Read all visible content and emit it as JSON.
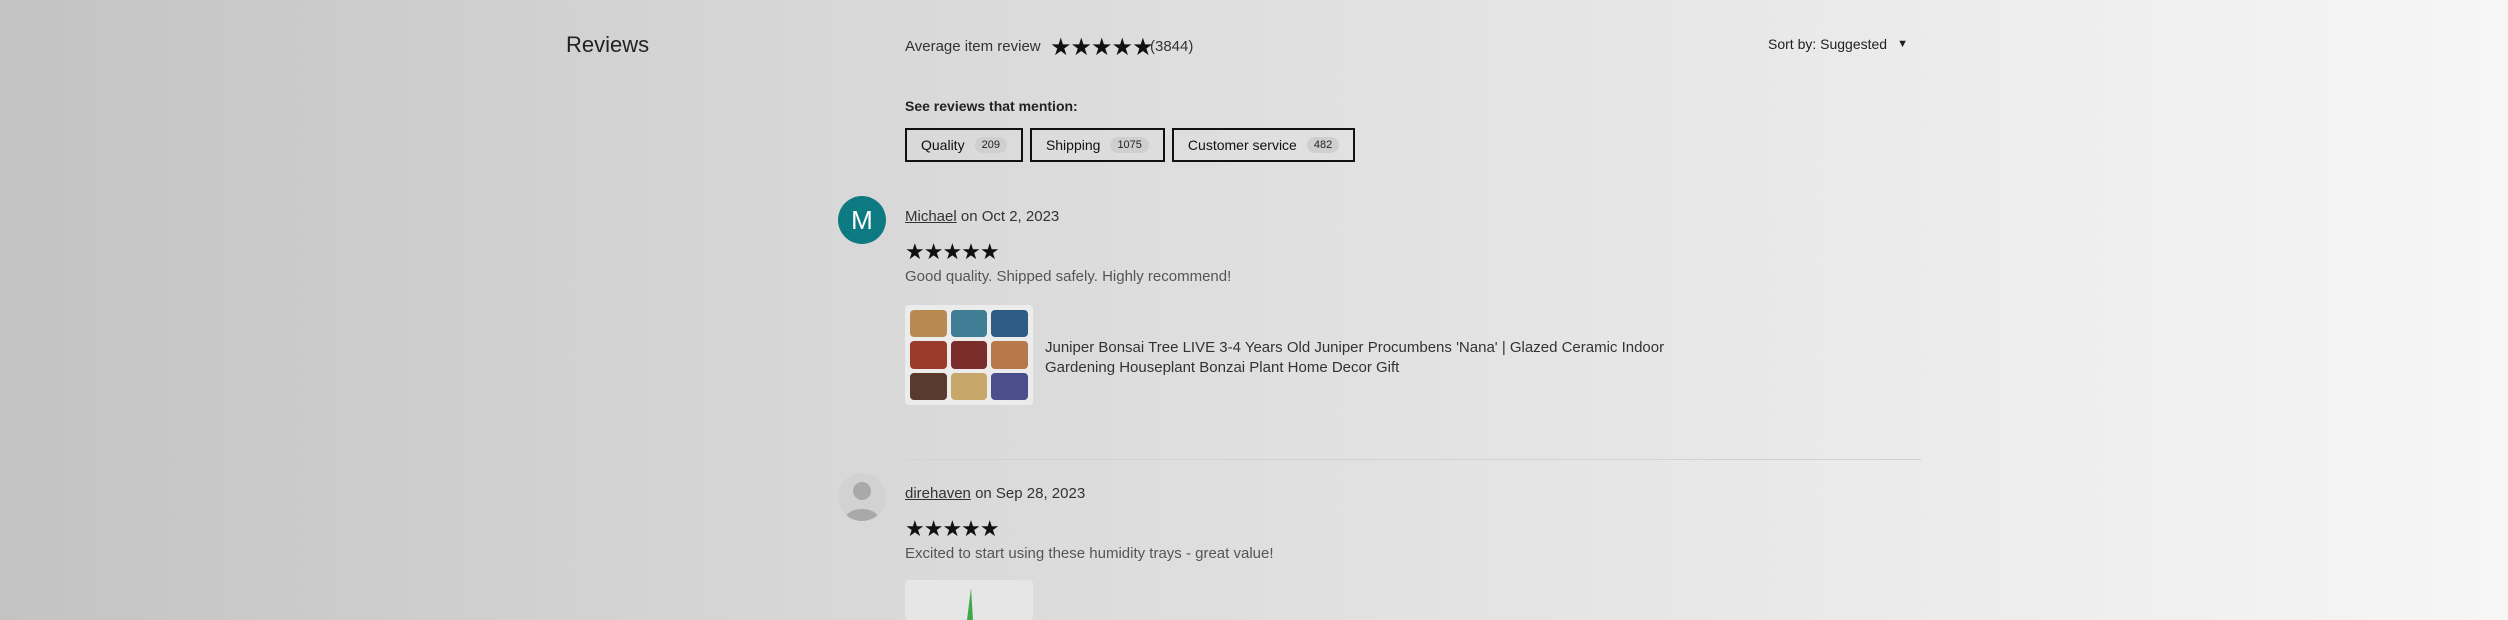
{
  "reviews_section": {
    "title": "Reviews",
    "average_label": "Average item review",
    "average_stars": "★★★★★",
    "average_count": "(3844)",
    "sort_label": "Sort by: Suggested",
    "mention_label": "See reviews that mention:",
    "chips": [
      {
        "label": "Quality",
        "count": "209"
      },
      {
        "label": "Shipping",
        "count": "1075"
      },
      {
        "label": "Customer service",
        "count": "482"
      }
    ]
  },
  "reviews": [
    {
      "avatar_letter": "M",
      "reviewer": "Michael",
      "date_text": "on Oct 2, 2023",
      "stars": "★★★★★",
      "text": "Good quality. Shipped safely. Highly recommend!",
      "listing_title": "Juniper Bonsai Tree LIVE 3-4 Years Old Juniper Procumbens 'Nana' | Glazed Ceramic Indoor Gardening Houseplant Bonzai Plant Home Decor Gift"
    },
    {
      "reviewer": "direhaven",
      "date_text": "on Sep 28, 2023",
      "stars": "★★★★★",
      "text": "Excited to start using these humidity trays - great value!"
    }
  ],
  "colors": {
    "avatar_teal": "#0d7a82",
    "chip_border": "#111111"
  },
  "icons": [
    "caret-down-icon",
    "star-icon",
    "default-avatar-icon"
  ]
}
